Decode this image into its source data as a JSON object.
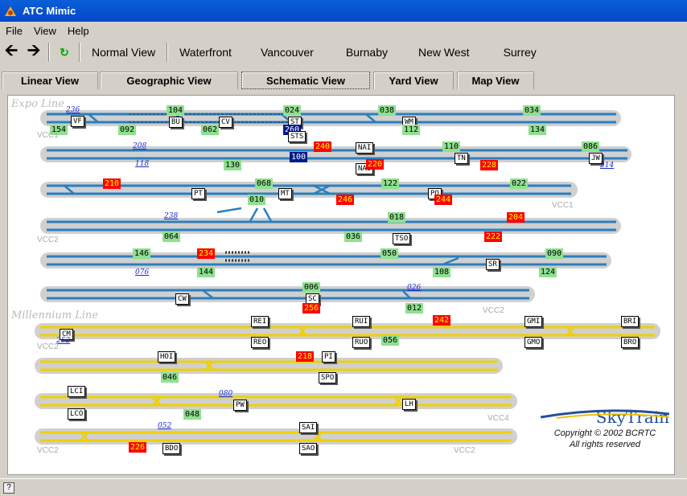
{
  "window": {
    "title": "ATC Mimic"
  },
  "menu": [
    "File",
    "View",
    "Help"
  ],
  "toolbar": {
    "views": [
      "Normal View",
      "Waterfront",
      "Vancouver",
      "Burnaby",
      "New West",
      "Surrey"
    ]
  },
  "tabs": [
    "Linear View",
    "Geographic View",
    "Schematic View",
    "Yard View",
    "Map View"
  ],
  "active_tab": "Schematic View",
  "sections": {
    "expo": "Expo Line",
    "millennium": "Millennium Line"
  },
  "branding": {
    "name": "SkyTrain",
    "copyright": "Copyright © 2002 BCRTC",
    "rights": "All rights reserved"
  },
  "colors": {
    "expo_track": "#2a7fc0",
    "millennium_track": "#f0d000",
    "track_bed": "#c8c8c8",
    "occupied_green": "#8fe08f",
    "alarm_red": "#ff0000",
    "selected_navy": "#001a8a"
  },
  "blocks": [
    {
      "id": "104",
      "c": "g"
    },
    {
      "id": "024",
      "c": "g"
    },
    {
      "id": "038",
      "c": "g"
    },
    {
      "id": "034",
      "c": "g"
    },
    {
      "id": "154",
      "c": "g"
    },
    {
      "id": "092",
      "c": "g"
    },
    {
      "id": "062",
      "c": "g"
    },
    {
      "id": "260",
      "c": "n"
    },
    {
      "id": "112",
      "c": "g"
    },
    {
      "id": "134",
      "c": "g"
    },
    {
      "id": "240",
      "c": "r"
    },
    {
      "id": "110",
      "c": "g"
    },
    {
      "id": "086",
      "c": "g"
    },
    {
      "id": "100",
      "c": "n"
    },
    {
      "id": "130",
      "c": "g"
    },
    {
      "id": "220",
      "c": "r"
    },
    {
      "id": "228",
      "c": "r"
    },
    {
      "id": "210",
      "c": "r"
    },
    {
      "id": "068",
      "c": "g"
    },
    {
      "id": "122",
      "c": "g"
    },
    {
      "id": "022",
      "c": "g"
    },
    {
      "id": "010",
      "c": "g"
    },
    {
      "id": "246",
      "c": "r"
    },
    {
      "id": "244",
      "c": "r"
    },
    {
      "id": "018",
      "c": "g"
    },
    {
      "id": "204",
      "c": "r"
    },
    {
      "id": "064",
      "c": "g"
    },
    {
      "id": "036",
      "c": "g"
    },
    {
      "id": "222",
      "c": "r"
    },
    {
      "id": "146",
      "c": "g"
    },
    {
      "id": "234",
      "c": "r"
    },
    {
      "id": "050",
      "c": "g"
    },
    {
      "id": "090",
      "c": "g"
    },
    {
      "id": "144",
      "c": "g"
    },
    {
      "id": "108",
      "c": "g"
    },
    {
      "id": "124",
      "c": "g"
    },
    {
      "id": "006",
      "c": "g"
    },
    {
      "id": "256",
      "c": "r"
    },
    {
      "id": "012",
      "c": "g"
    },
    {
      "id": "242",
      "c": "r"
    },
    {
      "id": "056",
      "c": "g"
    },
    {
      "id": "218",
      "c": "r"
    },
    {
      "id": "046",
      "c": "g"
    },
    {
      "id": "048",
      "c": "g"
    },
    {
      "id": "226",
      "c": "r"
    }
  ],
  "stations": [
    "VF",
    "BU",
    "CV",
    "ST",
    "STS",
    "WM",
    "NAI",
    "NAO",
    "TN",
    "JW",
    "PT",
    "MT",
    "PO",
    "TSO",
    "SR",
    "CW",
    "SC",
    "REI",
    "RUI",
    "GMI",
    "BRI",
    "CM",
    "REO",
    "RUO",
    "GMO",
    "BRO",
    "HOI",
    "PI",
    "SPO",
    "LCI",
    "PW",
    "LH",
    "LCO",
    "SAI",
    "SAO",
    "BDO"
  ],
  "signals": [
    "236",
    "208",
    "118",
    "214",
    "238",
    "076",
    "026",
    "252",
    "080",
    "052"
  ],
  "vcc": [
    "VCC1",
    "VCC1",
    "VCC2",
    "VCC2",
    "VCC2",
    "VCC4",
    "VCC4",
    "VCC2",
    "VCC2"
  ]
}
